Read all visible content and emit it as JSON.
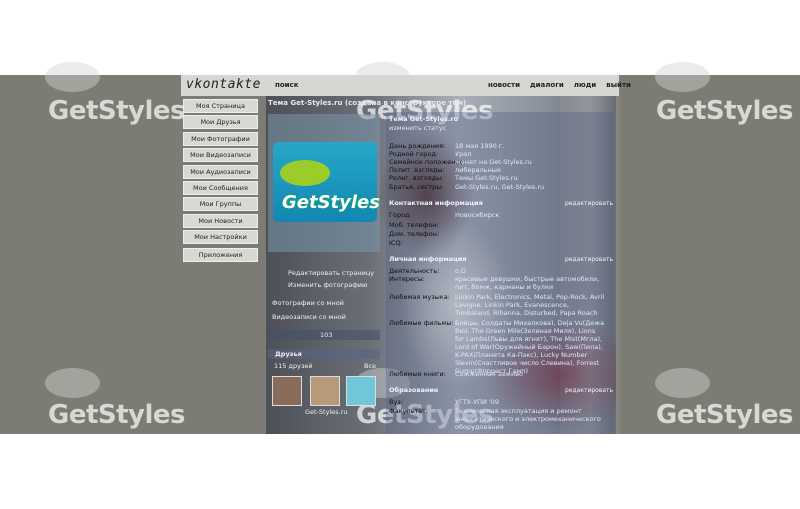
{
  "header": {
    "logo": "vkontakte",
    "search": "поиск",
    "links": [
      "новости",
      "диалоги",
      "люди",
      "выйти"
    ]
  },
  "nav": {
    "items": [
      "Моя Страница",
      "Мои Друзья",
      "Мои Фотографии",
      "Мои Видеозаписи",
      "Мои Аудиозаписи",
      "Мои Сообщения",
      "Мои Группы",
      "Мои Новости",
      "Мои Настройки"
    ],
    "apps": "Приложения"
  },
  "profile": {
    "title": "Тема Get-Styles.ru (создана в конструкторе тем)",
    "avatar_text": "GetStyles",
    "actions": [
      "Редактировать страницу",
      "Изменить фотографию"
    ],
    "photos_with_me": "Фотографии со мной",
    "videos_with_me": "Видеозаписи со мной",
    "rating": "103",
    "friends_label": "Друзья",
    "friends_count": "115 друзей",
    "friends_all": "Все",
    "friend_caption": "Get-Styles.ru"
  },
  "info": {
    "name": "Тема Get-Styles.ru",
    "status": "изменить статус",
    "rows": [
      {
        "label": "День рождения:",
        "value": "18 мая 1990 г."
      },
      {
        "label": "Родной город:",
        "value": "Урал"
      },
      {
        "label": "Семейное положение:",
        "value": "женат на Get-Styles.ru"
      },
      {
        "label": "Полит. взгляды:",
        "value": "либеральные"
      },
      {
        "label": "Религ. взгляды:",
        "value": "Темы Get-Styles.ru"
      },
      {
        "label": "Братья, сестры:",
        "value": "Get-Styles.ru, Get-Styles.ru"
      }
    ],
    "contact_head": "Контактная информация",
    "contact_rows": [
      {
        "label": "Город:",
        "value": "Новосибирск"
      },
      {
        "label": "Моб. телефон:",
        "value": ""
      },
      {
        "label": "Дом. телефон:",
        "value": ""
      },
      {
        "label": "ICQ:",
        "value": ""
      }
    ],
    "personal_head": "Личная информация",
    "personal_rows": [
      {
        "label": "Деятельность:",
        "value": "o.O"
      },
      {
        "label": "Интересы:",
        "value": "красивые девушки, быстрые автомобили, пит, бомж, карманы и булки"
      },
      {
        "label": "Любимая музыка:",
        "value": "Linkin Park, Electronics, Metal, Pop-Rock, Avril Lavigne, Linkin Park, Evanescence, Timbaland, Rihanna, Disturbed, Papa Roach"
      },
      {
        "label": "Любимые фильмы:",
        "value": "Бойцы, Солдаты Михалкова), Deja Vu(Дежа Вю), The Green Mile(Зеленая Миля), Lions for Lambs(Львы для ягнят), The Mist(Мгла), Lord of War(Оружейный Барон), Saw(Пила), K-PAX(Планета Ка-Пэкс), Lucky Number Slevin(Счастливое число Слевина), Forrest Gump(Форрест Гамп)"
      },
      {
        "label": "Любимые книги:",
        "value": "Сожженная заживо"
      }
    ],
    "edit": "редактировать",
    "edu_head": "Образование",
    "edu_rows": [
      {
        "label": "Вуз:",
        "value": "УГТУ-УПИ '09"
      },
      {
        "label": "Факультет:",
        "value": "Техническая эксплуатация и ремонт"
      },
      {
        "label": "",
        "value": "энергетического и электромеханического"
      },
      {
        "label": "",
        "value": "оборудования"
      }
    ]
  },
  "watermark": "GetStyles"
}
